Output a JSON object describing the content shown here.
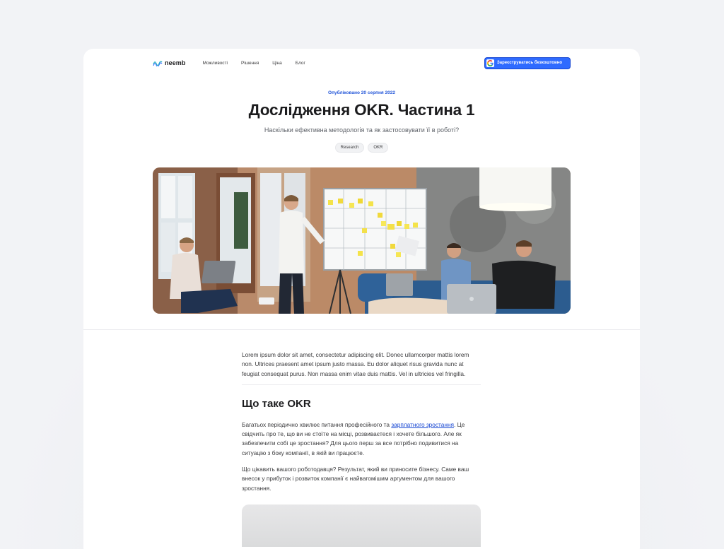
{
  "nav": {
    "logo_text": "neemb",
    "menu": [
      "Можливості",
      "Рішення",
      "Ціна",
      "Блог"
    ],
    "signup_label": "Зареєструватись безкоштовно"
  },
  "hero": {
    "published": "Опубліковано 20 серпня 2022",
    "title": "Дослідження OKR. Частина 1",
    "subtitle": "Наскільки ефективна методологія та як застосовувати її в роботі?",
    "tags": [
      "Research",
      "OKR"
    ]
  },
  "article": {
    "intro": "Lorem ipsum dolor sit amet, consectetur adipiscing elit. Donec ullamcorper mattis lorem non. Ultrices praesent amet ipsum justo massa. Eu dolor aliquet risus gravida nunc at feugiat consequat purus. Non massa enim vitae duis mattis. Vel in ultricies vel fringilla.",
    "heading": "Що таке OKR",
    "p1_before": "Багатьох періодично хвилює питання професійного та ",
    "p1_link": "зарплатного зростання",
    "p1_after": ". Це свідчить про те, що ви не стоїте на місці, розвиваєтеся і хочете більшого. Але як забезпечити собі це зростання? Для цього перш за все потрібно подивитися на ситуацію з боку компанії, в якій ви працюєте.",
    "p2": "Що цікавить вашого роботодавця? Результат, який ви приносите бізнесу. Саме ваш внесок у прибуток і розвиток компанії є найвагомішим аргументом для вашого зростання."
  },
  "colors": {
    "accent": "#2f6bff",
    "link": "#1747d3",
    "published": "#2457d9"
  }
}
